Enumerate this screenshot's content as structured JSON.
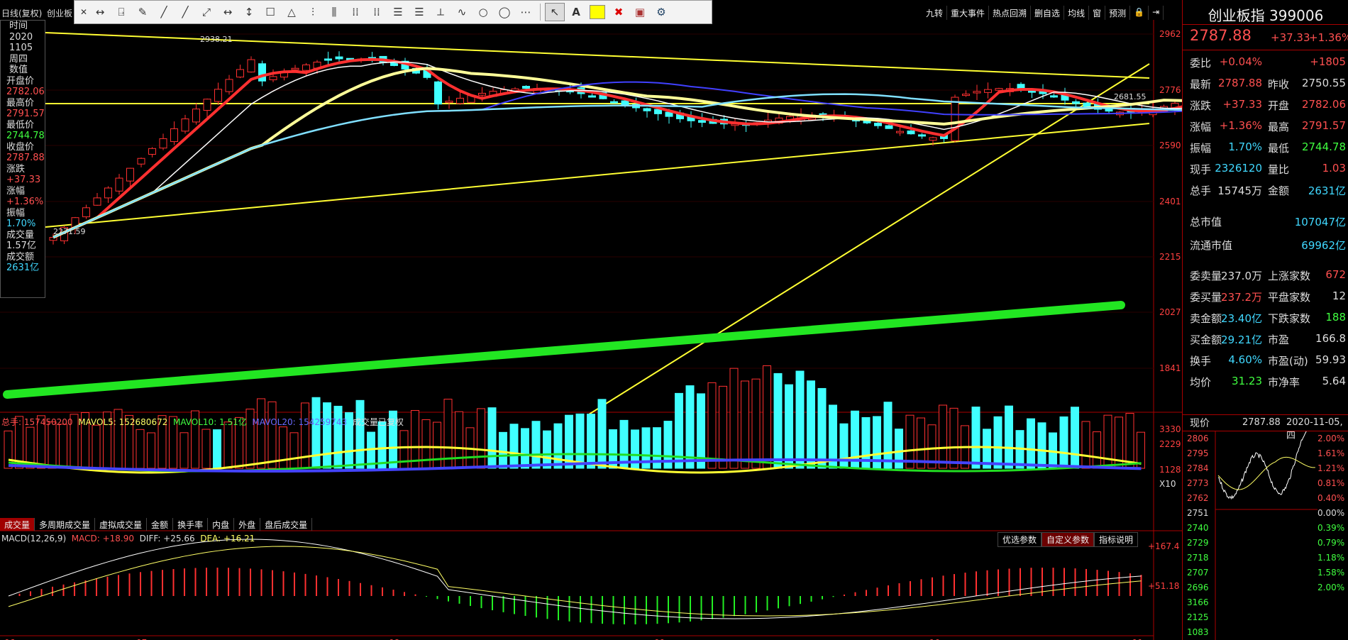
{
  "topbar": {
    "tab_daily": "日线(复权)",
    "tab_index": "创业板"
  },
  "toolbar": {
    "tools": [
      "↔",
      "⍈",
      "✎",
      "╱",
      "╱",
      "⤢",
      "↔",
      "↕",
      "☐",
      "△",
      "⫶",
      "⫼",
      "⁞⁞",
      "⁞⁞",
      "☰",
      "☰",
      "⟂",
      "∿",
      "○",
      "◯",
      "⋯"
    ],
    "select_icon": "↖",
    "text_icon": "A",
    "color_swatch": "#ffff00",
    "delete_icon": "✖",
    "template_icon": "▣",
    "settings_icon": "⚙"
  },
  "right_tabs": [
    "九转",
    "重大事件",
    "热点回溯",
    "删自选",
    "均线",
    "窗",
    "预测",
    "🔒",
    "⇥"
  ],
  "info_panel": {
    "labels": [
      "时间",
      "2020",
      "1105",
      "周四",
      "数值",
      "开盘价",
      "2782.06",
      "最高价",
      "2791.57",
      "最低价",
      "2744.78",
      "收盘价",
      "2787.88",
      "涨跌",
      "+37.33",
      "涨幅",
      "+1.36%",
      "振幅",
      "1.70%",
      "成交量",
      "1.57亿",
      "成交额",
      "2631亿"
    ]
  },
  "main_chart": {
    "price_axis": [
      "2962",
      "2776",
      "2590",
      "2401",
      "2215",
      "2027",
      "1841"
    ],
    "high_label": "2938.21",
    "low_label": "2271.59",
    "line_label": "2681.55",
    "date_labels": [
      "06",
      "07",
      "08",
      "09",
      "10",
      "11"
    ]
  },
  "volume_panel": {
    "legend": {
      "total": "总手: 157450200",
      "ma5": "MAVOL5: 152680672",
      "ma10": "MAVOL10: 1.51亿",
      "ma20": "MAVOL20: 154259743",
      "note": "成交量已复权"
    },
    "axis": [
      "3330",
      "2229",
      "1128",
      "X10"
    ]
  },
  "bottom_tabs": [
    "成交量",
    "多周期成交量",
    "虚拟成交量",
    "金额",
    "换手率",
    "内盘",
    "外盘",
    "盘后成交量"
  ],
  "macd_panel": {
    "name": "MACD(12,26,9)",
    "macd": "MACD: +18.90",
    "diff": "DIFF: +25.66",
    "dea": "DEA: +16.21",
    "axis_top": "+167.4",
    "axis_mid": "+51.18",
    "buttons": [
      "优选参数",
      "自定义参数",
      "指标说明"
    ]
  },
  "quote": {
    "title": "创业板指 399006",
    "price": "2787.88",
    "change": "+37.33",
    "change_pct": "+1.36%",
    "rows": [
      {
        "l1": "委比",
        "v1": "+0.04%",
        "c1": "#ff5050",
        "l2": "",
        "v2": "+1805",
        "c2": "#ff5050"
      },
      {
        "l1": "最新",
        "v1": "2787.88",
        "c1": "#ff5050",
        "l2": "昨收",
        "v2": "2750.55",
        "c2": "#ddd"
      },
      {
        "l1": "涨跌",
        "v1": "+37.33",
        "c1": "#ff5050",
        "l2": "开盘",
        "v2": "2782.06",
        "c2": "#ff5050"
      },
      {
        "l1": "涨幅",
        "v1": "+1.36%",
        "c1": "#ff5050",
        "l2": "最高",
        "v2": "2791.57",
        "c2": "#ff5050"
      },
      {
        "l1": "振幅",
        "v1": "1.70%",
        "c1": "#40d8ff",
        "l2": "最低",
        "v2": "2744.78",
        "c2": "#40ff40"
      },
      {
        "l1": "现手",
        "v1": "2326120",
        "c1": "#40d8ff",
        "l2": "量比",
        "v2": "1.03",
        "c2": "#ff5050"
      },
      {
        "l1": "总手",
        "v1": "15745万",
        "c1": "#ddd",
        "l2": "金额",
        "v2": "2631亿",
        "c2": "#40d8ff"
      }
    ],
    "mcap_rows": [
      {
        "l": "总市值",
        "v": "107047亿"
      },
      {
        "l": "流通市值",
        "v": "69962亿"
      }
    ],
    "order_rows": [
      {
        "l1": "委卖量",
        "v1": "237.0万",
        "c1": "#ddd",
        "l2": "上涨家数",
        "v2": "672",
        "c2": "#ff5050"
      },
      {
        "l1": "委买量",
        "v1": "237.2万",
        "c1": "#ff5050",
        "l2": "平盘家数",
        "v2": "12",
        "c2": "#ddd"
      },
      {
        "l1": "卖金额",
        "v1": "23.40亿",
        "c1": "#40d8ff",
        "l2": "下跌家数",
        "v2": "188",
        "c2": "#40ff40"
      },
      {
        "l1": "买金额",
        "v1": "29.21亿",
        "c1": "#40d8ff",
        "l2": "市盈",
        "v2": "166.8",
        "c2": "#ddd"
      },
      {
        "l1": "换手",
        "v1": "4.60%",
        "c1": "#40d8ff",
        "l2": "市盈(动)",
        "v2": "59.93",
        "c2": "#ddd"
      },
      {
        "l1": "均价",
        "v1": "31.23",
        "c1": "#40ff40",
        "l2": "市净率",
        "v2": "5.64",
        "c2": "#ddd"
      }
    ],
    "current_label": "现价",
    "current_value": "2787.88",
    "current_date": "2020-11-05,四",
    "mini_left": [
      "2806",
      "2795",
      "2784",
      "2773",
      "2762",
      "2751",
      "2740",
      "2729",
      "2718",
      "2707",
      "2696",
      "3166",
      "2125",
      "1083"
    ],
    "mini_right": [
      "2.00%",
      "1.61%",
      "1.21%",
      "0.81%",
      "0.40%",
      "0.00%",
      "0.39%",
      "0.79%",
      "1.18%",
      "1.58%",
      "2.00%"
    ]
  },
  "colors": {
    "up": "#ff5050",
    "down": "#40ffff",
    "trend_line": "#ffff33",
    "support_line": "#22e622",
    "panel_border": "#aa0000"
  }
}
